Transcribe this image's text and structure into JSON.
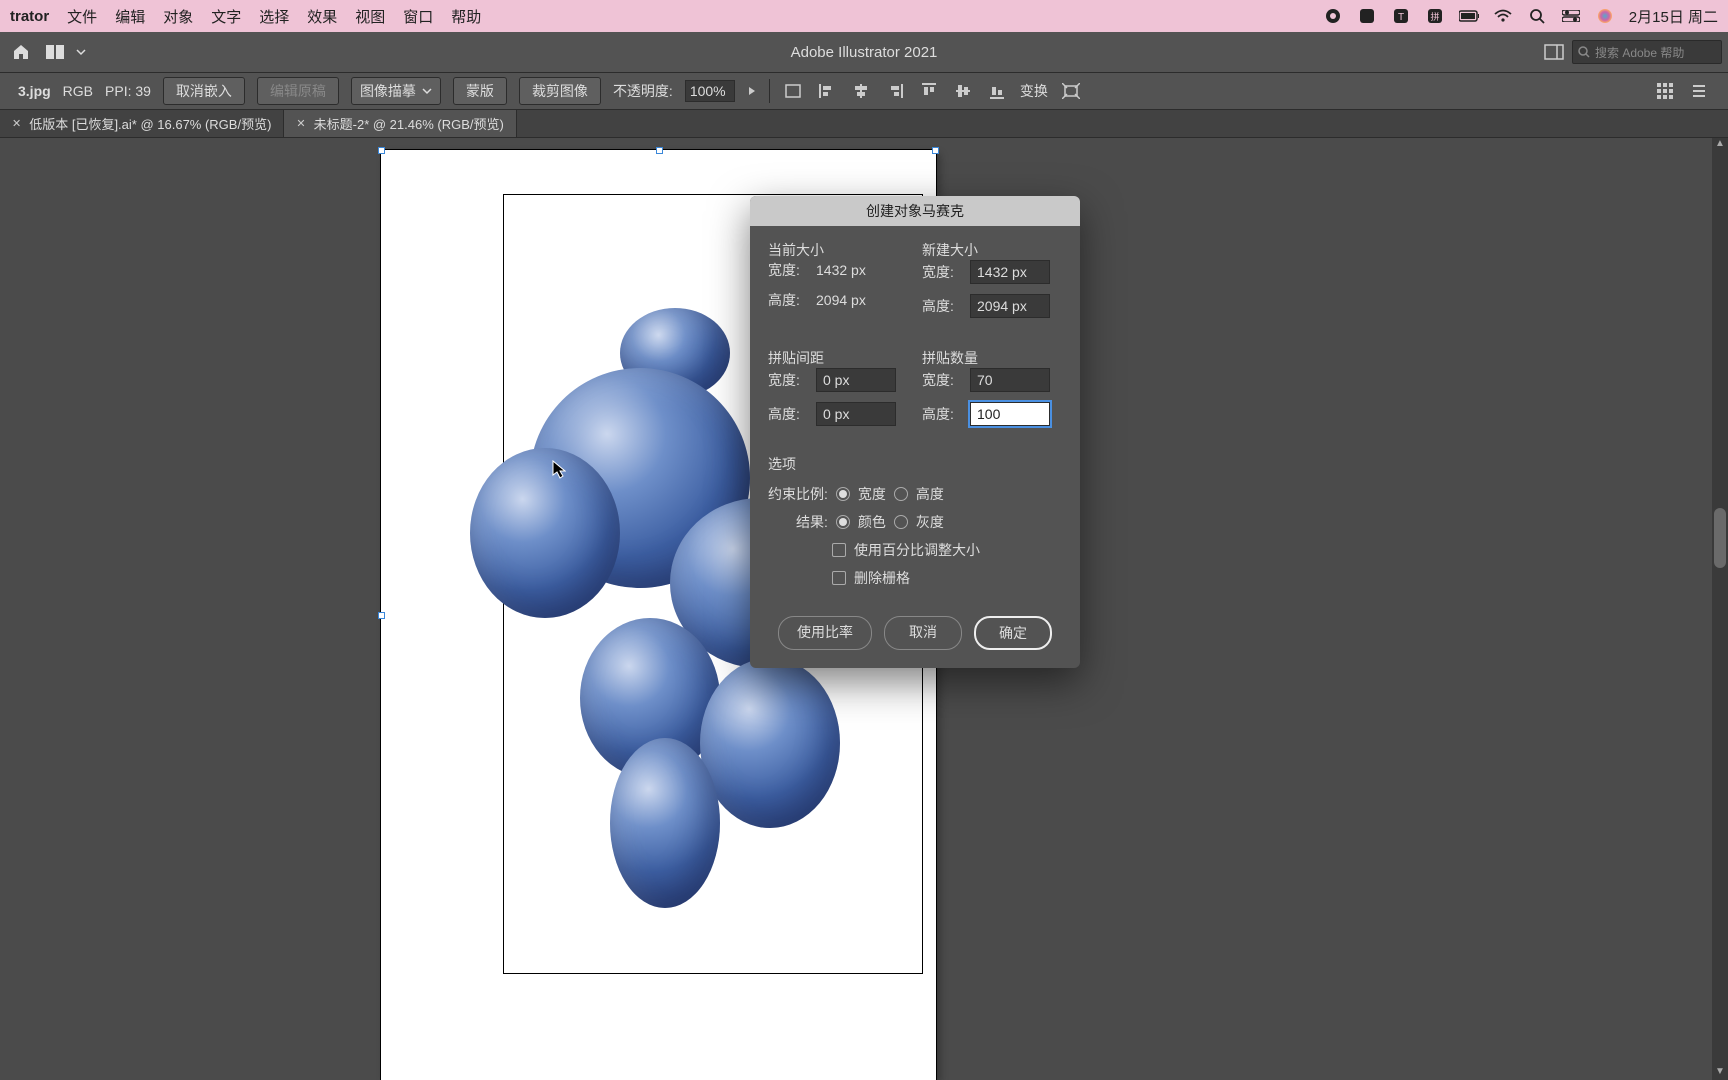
{
  "mac_menu": {
    "app_name": "trator",
    "items": [
      "文件",
      "编辑",
      "对象",
      "文字",
      "选择",
      "效果",
      "视图",
      "窗口",
      "帮助"
    ],
    "date": "2月15日 周二"
  },
  "app_titlebar": {
    "title": "Adobe Illustrator 2021",
    "search_placeholder": "搜索 Adobe 帮助"
  },
  "control_bar": {
    "filename": "3.jpg",
    "colormode": "RGB",
    "ppi_label": "PPI: 39",
    "unembed": "取消嵌入",
    "edit_original": "编辑原稿",
    "image_trace": "图像描摹",
    "mask": "蒙版",
    "crop": "裁剪图像",
    "opacity_label": "不透明度:",
    "opacity_value": "100%",
    "transform": "变换"
  },
  "tabs": [
    {
      "label": "低版本 [已恢复].ai* @ 16.67% (RGB/预览)"
    },
    {
      "label": "未标题-2* @ 21.46% (RGB/预览)"
    }
  ],
  "dialog": {
    "title": "创建对象马赛克",
    "current_size_label": "当前大小",
    "new_size_label": "新建大小",
    "width_label": "宽度:",
    "height_label": "高度:",
    "current_width": "1432 px",
    "current_height": "2094 px",
    "new_width": "1432 px",
    "new_height": "2094 px",
    "tile_spacing_label": "拼贴间距",
    "tile_count_label": "拼贴数量",
    "spacing_w": "0 px",
    "spacing_h": "0 px",
    "count_w": "70",
    "count_h": "100",
    "options_label": "选项",
    "constrain_label": "约束比例:",
    "constrain_width": "宽度",
    "constrain_height": "高度",
    "result_label": "结果:",
    "result_color": "颜色",
    "result_gray": "灰度",
    "use_percent": "使用百分比调整大小",
    "delete_raster": "删除栅格",
    "use_ratio_btn": "使用比率",
    "cancel_btn": "取消",
    "ok_btn": "确定"
  }
}
